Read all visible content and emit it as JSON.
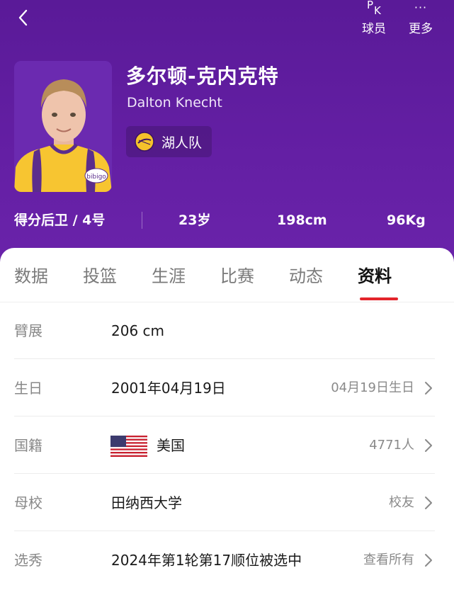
{
  "header": {
    "pk_label": "球员",
    "pk_glyph_p": "P",
    "pk_glyph_k": "K",
    "more_label": "更多",
    "more_glyph": "···",
    "back_icon": "chevron-left-icon"
  },
  "player": {
    "name_cn": "多尔顿-克内克特",
    "name_en": "Dalton Knecht",
    "team": "湖人队",
    "position_number": "得分后卫 / 4号",
    "age": "23岁",
    "height": "198cm",
    "weight": "96Kg",
    "jersey_text": "bibigo"
  },
  "tabs": [
    "数据",
    "投篮",
    "生涯",
    "比赛",
    "动态",
    "资料"
  ],
  "active_tab": "资料",
  "info_rows": [
    {
      "label": "臂展",
      "value": "206 cm",
      "right": ""
    },
    {
      "label": "生日",
      "value": "2001年04月19日",
      "right": "04月19日生日"
    },
    {
      "label": "国籍",
      "value": "美国",
      "right": "4771人"
    },
    {
      "label": "母校",
      "value": "田纳西大学",
      "right": "校友"
    },
    {
      "label": "选秀",
      "value": "2024年第1轮第17顺位被选中",
      "right": "查看所有"
    }
  ],
  "colors": {
    "header_bg": "#5f1d9e",
    "tab_active_underline": "#e3242b",
    "lakers_gold": "#f5c22b"
  }
}
